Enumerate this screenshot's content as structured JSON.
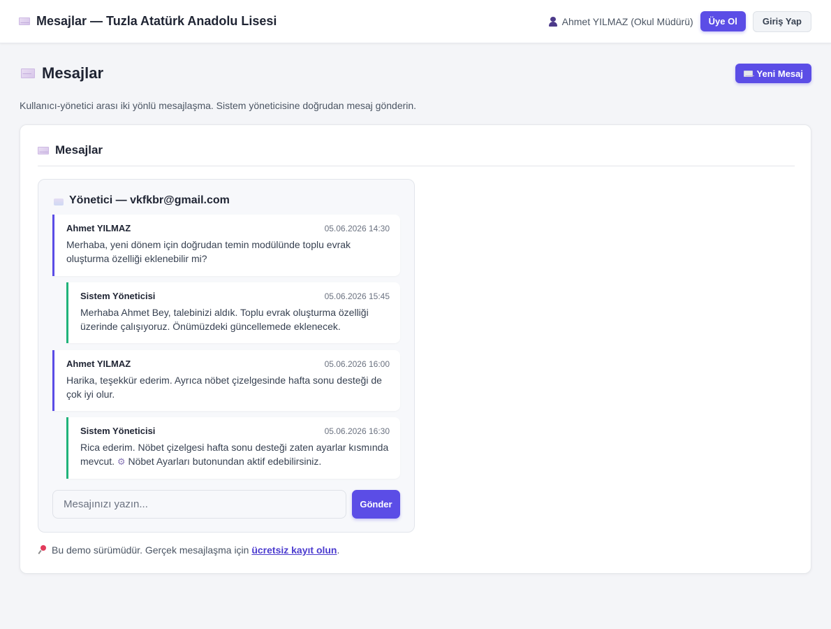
{
  "header": {
    "title": "Mesajlar — Tuzla Atatürk Anadolu Lisesi",
    "user": "Ahmet YILMAZ (Okul Müdürü)",
    "signup_label": "Üye Ol",
    "login_label": "Giriş Yap"
  },
  "page": {
    "title": "Mesajlar",
    "new_message_label": "Yeni Mesaj",
    "subtitle": "Kullanıcı-yönetici arası iki yönlü mesajlaşma. Sistem yöneticisine doğrudan mesaj gönderin."
  },
  "card": {
    "title": "Mesajlar"
  },
  "thread": {
    "title": "Yönetici — vkfkbr@gmail.com",
    "messages": [
      {
        "role": "user",
        "author": "Ahmet YILMAZ",
        "time": "05.06.2026 14:30",
        "text": "Merhaba, yeni dönem için doğrudan temin modülünde toplu evrak oluşturma özelliği eklenebilir mi?"
      },
      {
        "role": "admin",
        "author": "Sistem Yöneticisi",
        "time": "05.06.2026 15:45",
        "text": "Merhaba Ahmet Bey, talebinizi aldık. Toplu evrak oluşturma özelliği üzerinde çalışıyoruz. Önümüzdeki güncellemede eklenecek."
      },
      {
        "role": "user",
        "author": "Ahmet YILMAZ",
        "time": "05.06.2026 16:00",
        "text": "Harika, teşekkür ederim. Ayrıca nöbet çizelgesinde hafta sonu desteği de çok iyi olur."
      },
      {
        "role": "admin",
        "author": "Sistem Yöneticisi",
        "time": "05.06.2026 16:30",
        "text_before": "Rica ederim. Nöbet çizelgesi hafta sonu desteği zaten ayarlar kısmında mevcut.",
        "icon": "gear-icon",
        "text_after": "Nöbet Ayarları butonundan aktif edebilirsiniz."
      }
    ],
    "compose_placeholder": "Mesajınızı yazın...",
    "send_label": "Gönder"
  },
  "footer": {
    "note_before": "Bu demo sürümüdür. Gerçek mesajlaşma için",
    "link_text": "ücretsiz kayıt olun",
    "note_after": "."
  },
  "colors": {
    "accent": "#5b4de6",
    "admin_accent": "#1fb37a",
    "background": "#f4f5f8"
  }
}
